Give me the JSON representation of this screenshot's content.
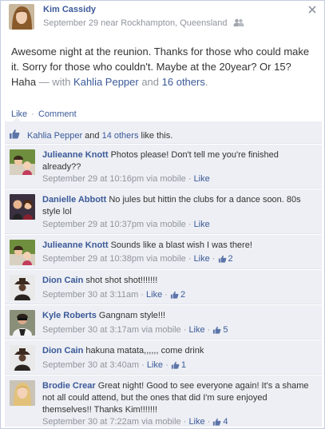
{
  "post": {
    "author": "Kim Cassidy",
    "meta": "September 29 near Rockhampton, Queensland",
    "text": "Awesome night at the reunion. Thanks for those who could make it. Sorry for those who couldn't. Maybe at the 20year? Or 15? Haha",
    "with_prefix": " — with ",
    "tagged_person": "Kahlia Pepper",
    "and_text": " and ",
    "tagged_others": "16 others",
    "period": "."
  },
  "actions": {
    "like": "Like",
    "separator": "·",
    "comment": "Comment"
  },
  "likes": {
    "person": "Kahlia Pepper",
    "and": " and ",
    "others": "14 others",
    "suffix": " like this."
  },
  "comments": [
    {
      "name": "Julieanne Knott",
      "text": "Photos please! Don't tell me you're finished already??",
      "time": "September 29 at 10:16pm via mobile",
      "like": "Like",
      "count": ""
    },
    {
      "name": "Danielle Abbott",
      "text": "No jules but hittin the clubs for a dance soon. 80s style lol",
      "time": "September 29 at 10:37pm via mobile",
      "like": "Like",
      "count": ""
    },
    {
      "name": "Julieanne Knott",
      "text": "Sounds like a blast wish I was there!",
      "time": "September 29 at 10:38pm via mobile",
      "like": "Like",
      "count": "2"
    },
    {
      "name": "Dion Cain",
      "text": "shot shot shot!!!!!!!",
      "time": "September 30 at 3:11am",
      "like": "Like",
      "count": "2"
    },
    {
      "name": "Kyle Roberts",
      "text": "Gangnam style!!!",
      "time": "September 30 at 3:17am via mobile",
      "like": "Like",
      "count": "5"
    },
    {
      "name": "Dion Cain",
      "text": "hakuna matata,,,,,, come drink",
      "time": "September 30 at 3:40am",
      "like": "Like",
      "count": "1"
    },
    {
      "name": "Brodie Crear",
      "text": "Great night! Good to see everyone again! It's a shame not all could attend, but the ones that did I'm sure enjoyed themselves!! Thanks Kim!!!!!!!",
      "time": "September 30 at 7:22am via mobile",
      "like": "Like",
      "count": "4"
    }
  ],
  "colors": {
    "link": "#3b5998",
    "muted": "#90949c",
    "ufi_bg": "#edeff4"
  },
  "icons": {
    "close": "close-icon",
    "friends": "friends-icon",
    "thumb": "thumbs-up-icon"
  }
}
